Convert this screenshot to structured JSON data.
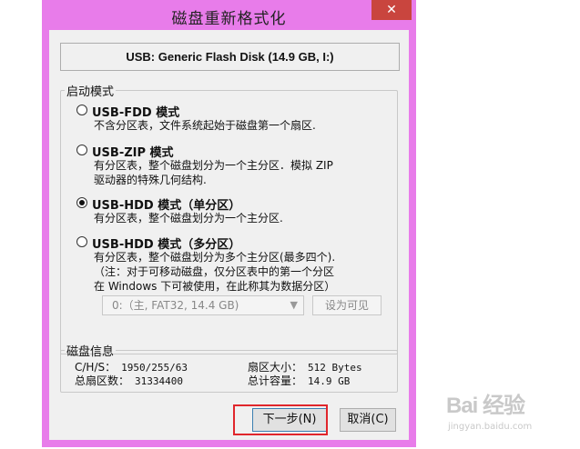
{
  "window": {
    "title": "磁盘重新格式化",
    "close_label": "✕"
  },
  "device": "USB: Generic Flash Disk (14.9 GB, I:)",
  "boot_mode": {
    "legend": "启动模式",
    "options": [
      {
        "label": "USB-FDD 模式",
        "checked": false,
        "desc": [
          "不含分区表，文件系统起始于磁盘第一个扇区."
        ]
      },
      {
        "label": "USB-ZIP 模式",
        "checked": false,
        "desc": [
          "有分区表，整个磁盘划分为一个主分区．模拟 ZIP",
          "驱动器的特殊几何结构."
        ]
      },
      {
        "label": "USB-HDD 模式（单分区）",
        "checked": true,
        "desc": [
          "有分区表，整个磁盘划分为一个主分区."
        ]
      },
      {
        "label": "USB-HDD 模式（多分区）",
        "checked": false,
        "desc": [
          "有分区表，整个磁盘划分为多个主分区(最多四个).",
          "（注：对于可移动磁盘，仅分区表中的第一个分区",
          "在 Windows 下可被使用，在此称其为数据分区）"
        ]
      }
    ],
    "partition_select": "0:（主, FAT32, 14.4 GB)",
    "set_visible_button": "设为可见"
  },
  "disk_info": {
    "legend": "磁盘信息",
    "chs_label": "C/H/S：",
    "chs_value": "1950/255/63",
    "sectors_label": "总扇区数：",
    "sectors_value": "31334400",
    "sector_size_label": "扇区大小：",
    "sector_size_value": "512 Bytes",
    "capacity_label": "总计容量：",
    "capacity_value": "14.9 GB"
  },
  "buttons": {
    "next": "下一步(N)",
    "cancel": "取消(C)"
  },
  "watermark": {
    "logo": "Bai 经验",
    "site": "jingyan.baidu.com"
  },
  "colors": {
    "window_frame": "#e87cea",
    "close_button": "#c9453e",
    "highlight": "#e0262c"
  }
}
